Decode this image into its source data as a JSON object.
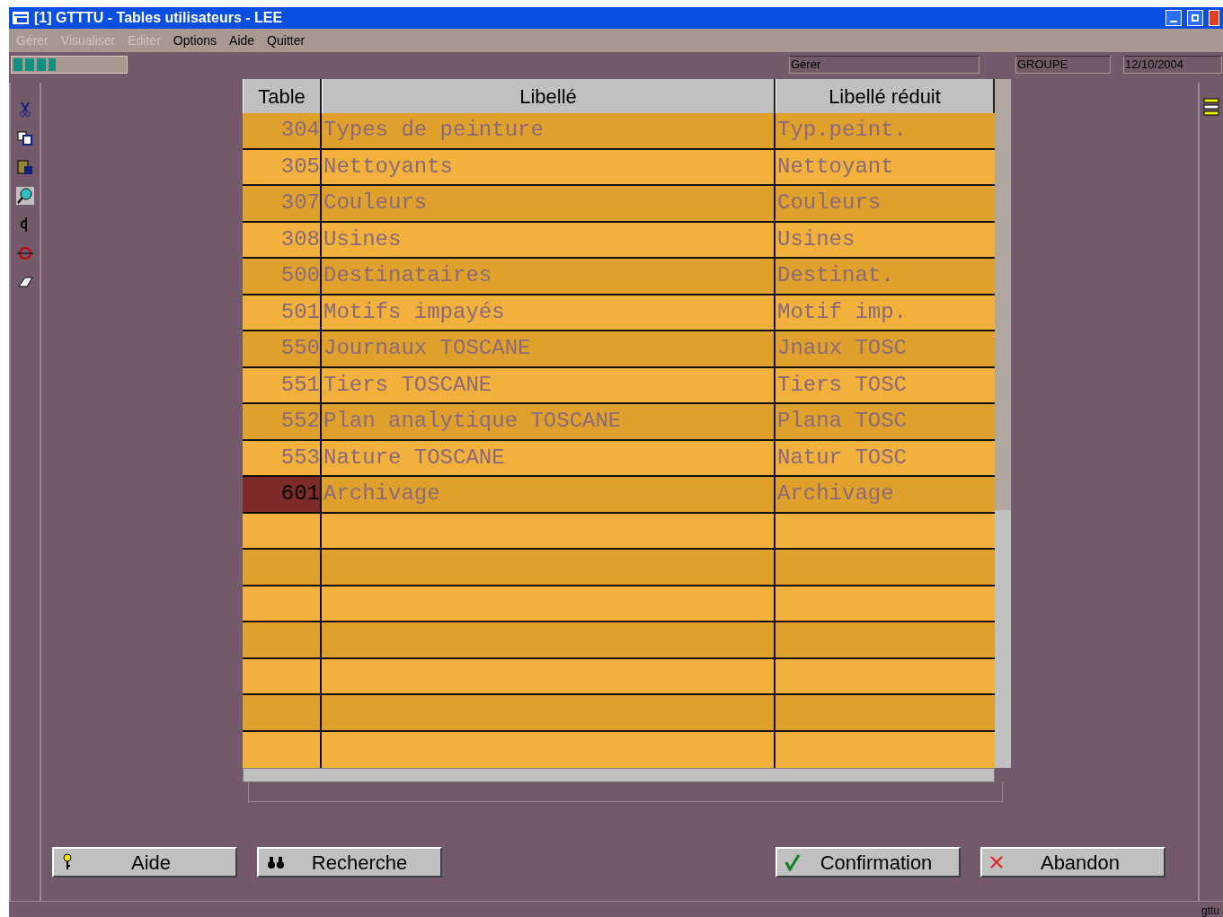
{
  "window": {
    "title": "[1] GTTTU - Tables utilisateurs - LEE"
  },
  "menu": [
    {
      "label": "Gérer",
      "disabled": true
    },
    {
      "label": "Visualiser",
      "disabled": true
    },
    {
      "label": "Editer",
      "disabled": true
    },
    {
      "label": "Options",
      "disabled": false
    },
    {
      "label": "Aide",
      "disabled": false
    },
    {
      "label": "Quitter",
      "disabled": false
    }
  ],
  "progress": {
    "level": 0.38
  },
  "fields": [
    {
      "value": "Gérer"
    },
    {
      "value": "GROUPE"
    },
    {
      "value": "12/10/2004"
    }
  ],
  "table": {
    "columns": [
      "Table",
      "Libellé",
      "Libellé réduit"
    ],
    "rows": [
      {
        "cells": [
          "304",
          "Types de peinture",
          "Typ.peint."
        ],
        "selected": false
      },
      {
        "cells": [
          "305",
          "Nettoyants",
          "Nettoyant"
        ],
        "selected": false
      },
      {
        "cells": [
          "307",
          "Couleurs",
          "Couleurs"
        ],
        "selected": false
      },
      {
        "cells": [
          "308",
          "Usines",
          "Usines"
        ],
        "selected": false
      },
      {
        "cells": [
          "500",
          "Destinataires",
          "Destinat."
        ],
        "selected": false
      },
      {
        "cells": [
          "501",
          "Motifs impayés",
          "Motif imp."
        ],
        "selected": false
      },
      {
        "cells": [
          "550",
          "Journaux TOSCANE",
          "Jnaux TOSC"
        ],
        "selected": false
      },
      {
        "cells": [
          "551",
          "Tiers TOSCANE",
          "Tiers TOSC"
        ],
        "selected": false
      },
      {
        "cells": [
          "552",
          "Plan analytique TOSCANE",
          "Plana TOSC"
        ],
        "selected": false
      },
      {
        "cells": [
          "553",
          "Nature TOSCANE",
          "Natur TOSC"
        ],
        "selected": false
      },
      {
        "cells": [
          "601",
          "Archivage",
          "Archivage"
        ],
        "selected": true
      }
    ]
  },
  "buttons": [
    {
      "label": "Aide"
    },
    {
      "label": "Recherche"
    },
    {
      "label": "Confirmation"
    },
    {
      "label": "Abandon"
    }
  ],
  "status_bar": {
    "text": "gttu"
  }
}
